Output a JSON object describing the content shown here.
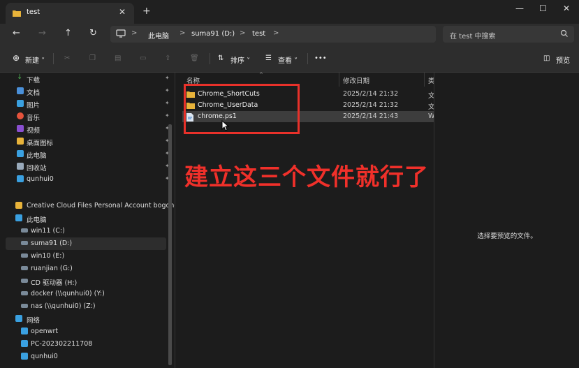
{
  "window": {
    "tab_title": "test",
    "new_tab": "+",
    "close_tab": "✕",
    "minimize": "—",
    "maximize": "☐",
    "close": "✕"
  },
  "address_bar": {
    "breadcrumbs": [
      "此电脑",
      "suma91 (D:)",
      "test"
    ],
    "separator": ">",
    "search_placeholder": "在 test 中搜索"
  },
  "toolbar": {
    "new_label": "新建",
    "sort_label": "排序",
    "view_label": "查看",
    "more_label": "•••",
    "preview_label": "预览"
  },
  "sidebar": {
    "quick_access": [
      {
        "label": "下载",
        "icon": "download-icon",
        "color": "#4caf50"
      },
      {
        "label": "文档",
        "icon": "document-icon",
        "color": "#4a90d9"
      },
      {
        "label": "图片",
        "icon": "picture-icon",
        "color": "#3aa0e0"
      },
      {
        "label": "音乐",
        "icon": "music-icon",
        "color": "#e5533c"
      },
      {
        "label": "视频",
        "icon": "video-icon",
        "color": "#8a4fd0"
      },
      {
        "label": "桌面图标",
        "icon": "folder-icon",
        "color": "#e8b33a"
      },
      {
        "label": "此电脑",
        "icon": "computer-icon",
        "color": "#3aa0e0"
      },
      {
        "label": "回收站",
        "icon": "recycle-bin-icon",
        "color": "#9ab"
      },
      {
        "label": "qunhui0",
        "icon": "network-computer-icon",
        "color": "#3aa0e0"
      }
    ],
    "creative_cloud": "Creative Cloud Files Personal Account bogond",
    "this_pc": "此电脑",
    "drives": [
      {
        "label": "win11 (C:)"
      },
      {
        "label": "suma91 (D:)"
      },
      {
        "label": "win10 (E:)"
      },
      {
        "label": "ruanjian (G:)"
      },
      {
        "label": "CD 驱动器 (H:)"
      },
      {
        "label": "docker (\\\\qunhui0) (Y:)"
      },
      {
        "label": "nas (\\\\qunhui0) (Z:)"
      }
    ],
    "network": "网络",
    "network_items": [
      {
        "label": "openwrt"
      },
      {
        "label": "PC-202302211708"
      },
      {
        "label": "qunhui0"
      }
    ],
    "pin_glyph": "📌"
  },
  "file_list": {
    "columns": {
      "name": "名称",
      "modified": "修改日期",
      "type": "类"
    },
    "rows": [
      {
        "name": "Chrome_ShortCuts",
        "modified": "2025/2/14 21:32",
        "type": "文",
        "kind": "folder"
      },
      {
        "name": "Chrome_UserData",
        "modified": "2025/2/14 21:32",
        "type": "文",
        "kind": "folder"
      },
      {
        "name": "chrome.ps1",
        "modified": "2025/2/14 21:43",
        "type": "W",
        "kind": "script"
      }
    ]
  },
  "annotation": "建立这三个文件就行了",
  "preview": {
    "message": "选择要预览的文件。"
  },
  "colors": {
    "accent_red": "#e8312a",
    "folder_yellow": "#e8b33a",
    "background": "#1c1c1c"
  }
}
